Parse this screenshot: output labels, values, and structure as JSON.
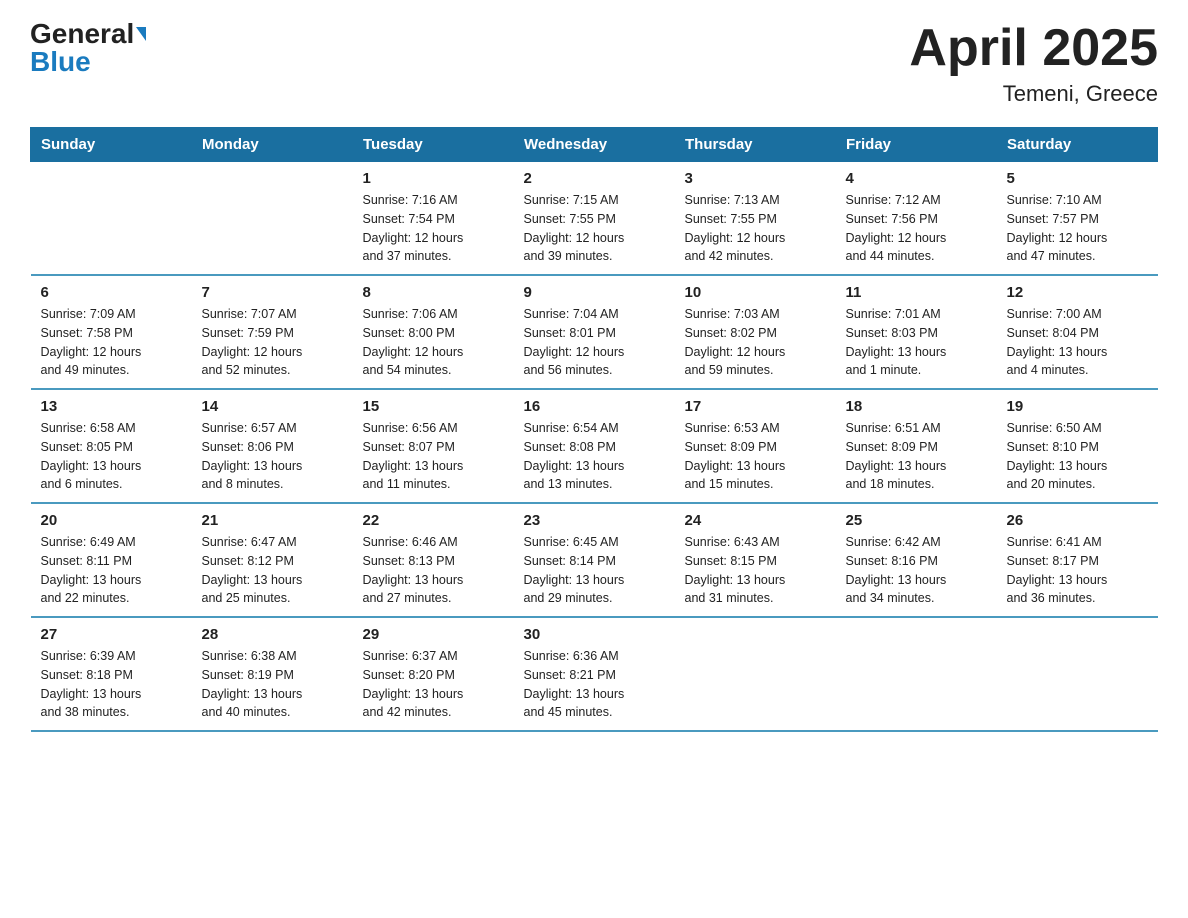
{
  "header": {
    "logo_general": "General",
    "logo_blue": "Blue",
    "title": "April 2025",
    "subtitle": "Temeni, Greece"
  },
  "weekdays": [
    "Sunday",
    "Monday",
    "Tuesday",
    "Wednesday",
    "Thursday",
    "Friday",
    "Saturday"
  ],
  "weeks": [
    [
      {
        "day": "",
        "info": ""
      },
      {
        "day": "",
        "info": ""
      },
      {
        "day": "1",
        "info": "Sunrise: 7:16 AM\nSunset: 7:54 PM\nDaylight: 12 hours\nand 37 minutes."
      },
      {
        "day": "2",
        "info": "Sunrise: 7:15 AM\nSunset: 7:55 PM\nDaylight: 12 hours\nand 39 minutes."
      },
      {
        "day": "3",
        "info": "Sunrise: 7:13 AM\nSunset: 7:55 PM\nDaylight: 12 hours\nand 42 minutes."
      },
      {
        "day": "4",
        "info": "Sunrise: 7:12 AM\nSunset: 7:56 PM\nDaylight: 12 hours\nand 44 minutes."
      },
      {
        "day": "5",
        "info": "Sunrise: 7:10 AM\nSunset: 7:57 PM\nDaylight: 12 hours\nand 47 minutes."
      }
    ],
    [
      {
        "day": "6",
        "info": "Sunrise: 7:09 AM\nSunset: 7:58 PM\nDaylight: 12 hours\nand 49 minutes."
      },
      {
        "day": "7",
        "info": "Sunrise: 7:07 AM\nSunset: 7:59 PM\nDaylight: 12 hours\nand 52 minutes."
      },
      {
        "day": "8",
        "info": "Sunrise: 7:06 AM\nSunset: 8:00 PM\nDaylight: 12 hours\nand 54 minutes."
      },
      {
        "day": "9",
        "info": "Sunrise: 7:04 AM\nSunset: 8:01 PM\nDaylight: 12 hours\nand 56 minutes."
      },
      {
        "day": "10",
        "info": "Sunrise: 7:03 AM\nSunset: 8:02 PM\nDaylight: 12 hours\nand 59 minutes."
      },
      {
        "day": "11",
        "info": "Sunrise: 7:01 AM\nSunset: 8:03 PM\nDaylight: 13 hours\nand 1 minute."
      },
      {
        "day": "12",
        "info": "Sunrise: 7:00 AM\nSunset: 8:04 PM\nDaylight: 13 hours\nand 4 minutes."
      }
    ],
    [
      {
        "day": "13",
        "info": "Sunrise: 6:58 AM\nSunset: 8:05 PM\nDaylight: 13 hours\nand 6 minutes."
      },
      {
        "day": "14",
        "info": "Sunrise: 6:57 AM\nSunset: 8:06 PM\nDaylight: 13 hours\nand 8 minutes."
      },
      {
        "day": "15",
        "info": "Sunrise: 6:56 AM\nSunset: 8:07 PM\nDaylight: 13 hours\nand 11 minutes."
      },
      {
        "day": "16",
        "info": "Sunrise: 6:54 AM\nSunset: 8:08 PM\nDaylight: 13 hours\nand 13 minutes."
      },
      {
        "day": "17",
        "info": "Sunrise: 6:53 AM\nSunset: 8:09 PM\nDaylight: 13 hours\nand 15 minutes."
      },
      {
        "day": "18",
        "info": "Sunrise: 6:51 AM\nSunset: 8:09 PM\nDaylight: 13 hours\nand 18 minutes."
      },
      {
        "day": "19",
        "info": "Sunrise: 6:50 AM\nSunset: 8:10 PM\nDaylight: 13 hours\nand 20 minutes."
      }
    ],
    [
      {
        "day": "20",
        "info": "Sunrise: 6:49 AM\nSunset: 8:11 PM\nDaylight: 13 hours\nand 22 minutes."
      },
      {
        "day": "21",
        "info": "Sunrise: 6:47 AM\nSunset: 8:12 PM\nDaylight: 13 hours\nand 25 minutes."
      },
      {
        "day": "22",
        "info": "Sunrise: 6:46 AM\nSunset: 8:13 PM\nDaylight: 13 hours\nand 27 minutes."
      },
      {
        "day": "23",
        "info": "Sunrise: 6:45 AM\nSunset: 8:14 PM\nDaylight: 13 hours\nand 29 minutes."
      },
      {
        "day": "24",
        "info": "Sunrise: 6:43 AM\nSunset: 8:15 PM\nDaylight: 13 hours\nand 31 minutes."
      },
      {
        "day": "25",
        "info": "Sunrise: 6:42 AM\nSunset: 8:16 PM\nDaylight: 13 hours\nand 34 minutes."
      },
      {
        "day": "26",
        "info": "Sunrise: 6:41 AM\nSunset: 8:17 PM\nDaylight: 13 hours\nand 36 minutes."
      }
    ],
    [
      {
        "day": "27",
        "info": "Sunrise: 6:39 AM\nSunset: 8:18 PM\nDaylight: 13 hours\nand 38 minutes."
      },
      {
        "day": "28",
        "info": "Sunrise: 6:38 AM\nSunset: 8:19 PM\nDaylight: 13 hours\nand 40 minutes."
      },
      {
        "day": "29",
        "info": "Sunrise: 6:37 AM\nSunset: 8:20 PM\nDaylight: 13 hours\nand 42 minutes."
      },
      {
        "day": "30",
        "info": "Sunrise: 6:36 AM\nSunset: 8:21 PM\nDaylight: 13 hours\nand 45 minutes."
      },
      {
        "day": "",
        "info": ""
      },
      {
        "day": "",
        "info": ""
      },
      {
        "day": "",
        "info": ""
      }
    ]
  ]
}
